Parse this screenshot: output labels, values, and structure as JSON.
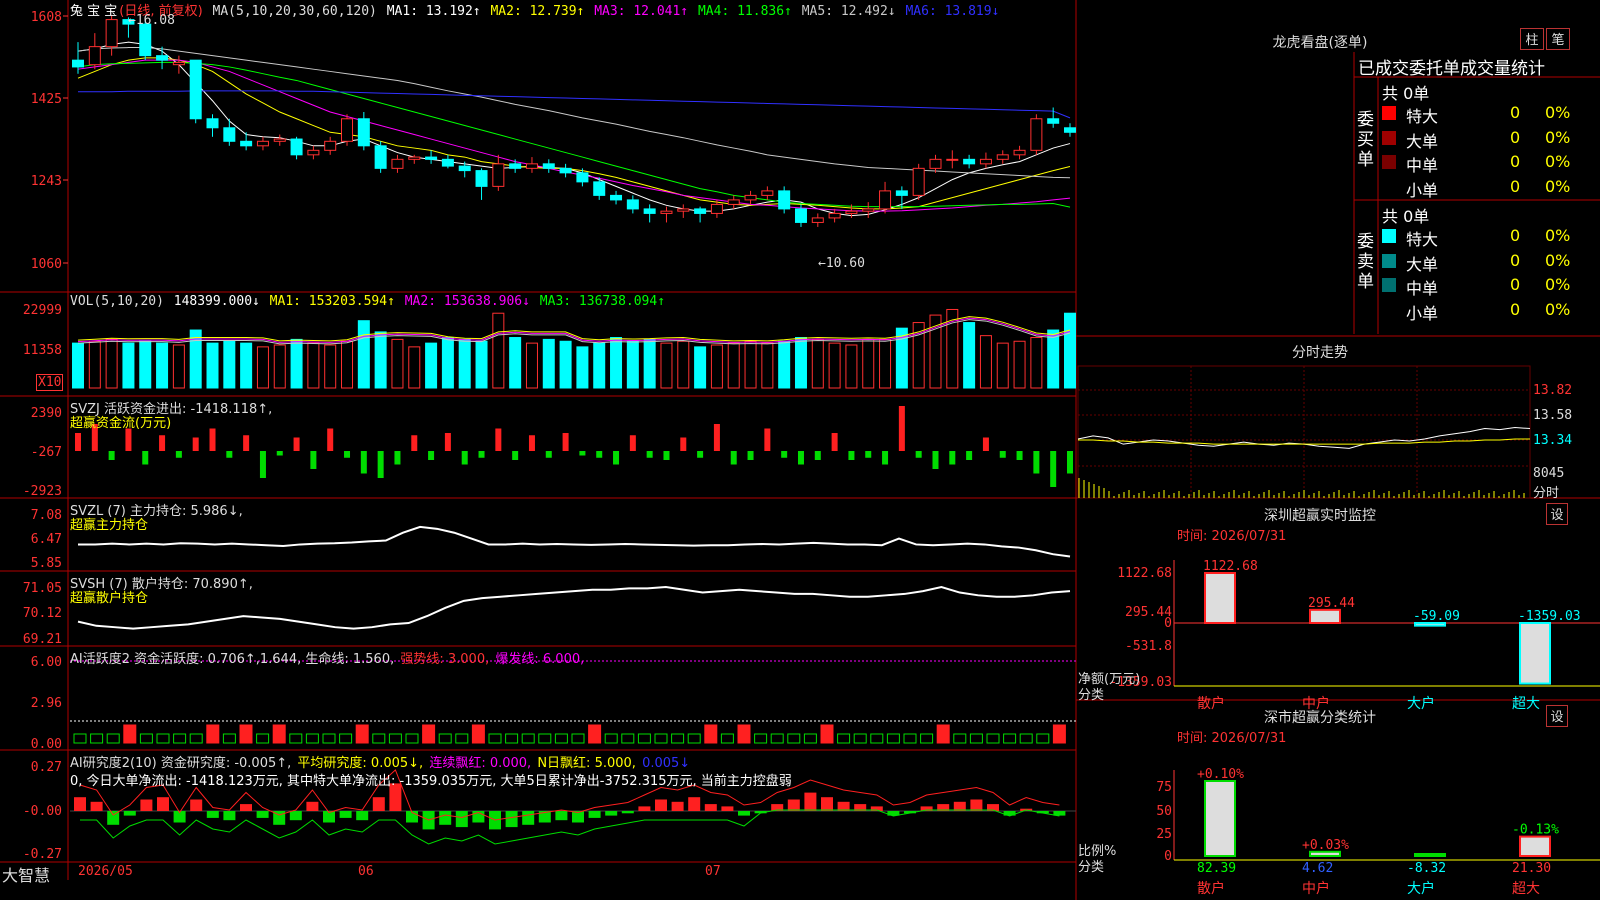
{
  "stock": {
    "name": "兔 宝 宝",
    "period": "(日线, 前复权)"
  },
  "top_header": {
    "ma_def": "MA(5,10,20,30,60,120)",
    "items": [
      {
        "label": "MA1:",
        "value": "13.192↑",
        "color": "#ffffff"
      },
      {
        "label": "MA2:",
        "value": "12.739↑",
        "color": "#ffff00"
      },
      {
        "label": "MA3:",
        "value": "12.041↑",
        "color": "#ff00ff"
      },
      {
        "label": "MA4:",
        "value": "11.836↑",
        "color": "#00ff00"
      },
      {
        "label": "MA5:",
        "value": "12.492↓",
        "color": "#c8c8c8"
      },
      {
        "label": "MA6:",
        "value": "13.819↓",
        "color": "#3030ff"
      }
    ],
    "high_mark": "16.08",
    "low_mark": "←10.60"
  },
  "price_axis": [
    "1608",
    "1425",
    "1243",
    "1060"
  ],
  "vol_panel": {
    "title": "VOL(5,10,20)",
    "vol": "148399.000↓",
    "ma1": "MA1: 153203.594↑",
    "ma2": "MA2: 153638.906↓",
    "ma3": "MA3: 136738.094↑",
    "axis": [
      "22999",
      "11358"
    ],
    "unit": "X10"
  },
  "svzj_panel": {
    "title": "SVZJ  活跃资金进出: -1418.118↑,",
    "subtitle": "超赢资金流(万元)",
    "axis": [
      "2390",
      "-267",
      "-2923"
    ]
  },
  "svzl_panel": {
    "title": "SVZL (7) 主力持仓: 5.986↓,",
    "subtitle": "超赢主力持仓",
    "axis": [
      "7.08",
      "6.47",
      "5.85"
    ]
  },
  "svsh_panel": {
    "title": "SVSH (7) 散户持仓: 70.890↑,",
    "subtitle": "超赢散户持仓",
    "axis": [
      "71.05",
      "70.12",
      "69.21"
    ]
  },
  "ai_active_panel": {
    "title": "AI活跃度2 资金活跃度: 0.706↑,1.644, 生命线: 1.560,",
    "strong": "强势线: 3.000,",
    "burst": "爆发线: 6.000,",
    "axis": [
      "6.00",
      "2.96",
      "0.00"
    ]
  },
  "ai_research_panel": {
    "title": "AI研究度2(10) 资金研究度: -0.005↑,",
    "avg": "平均研究度: 0.005↓,",
    "red": "连续飘红: 0.000,",
    "nred": "N日飘红: 5.000,",
    "last": "0.005↓",
    "summary": "0, 今日大单净流出: -1418.123万元, 其中特大单净流出: -1359.035万元, 大单5日累计净出-3752.315万元, 当前主力控盘弱",
    "axis": [
      "0.27",
      "-0.00",
      "-0.27"
    ]
  },
  "x_axis": {
    "brand": "大智慧",
    "labels": [
      "2026/05",
      "06",
      "07"
    ]
  },
  "right": {
    "lhb_title": "龙虎看盘(逐单)",
    "btn_column": "柱",
    "btn_stroke": "笔",
    "order_title": "已成交委托单成交量统计",
    "buy_label": "委买单",
    "sell_label": "委卖单",
    "buy_total": "共 0单",
    "sell_total": "共 0单",
    "buy_rows": [
      {
        "name": "特大",
        "count": "0",
        "pct": "0%",
        "color": "#ff0000"
      },
      {
        "name": "大单",
        "count": "0",
        "pct": "0%",
        "color": "#a00000"
      },
      {
        "name": "中单",
        "count": "0",
        "pct": "0%",
        "color": "#7a0000"
      },
      {
        "name": "小单",
        "count": "0",
        "pct": "0%",
        "color": ""
      }
    ],
    "sell_rows": [
      {
        "name": "特大",
        "count": "0",
        "pct": "0%",
        "color": "#00ffff"
      },
      {
        "name": "大单",
        "count": "0",
        "pct": "0%",
        "color": "#008b8b"
      },
      {
        "name": "中单",
        "count": "0",
        "pct": "0%",
        "color": "#007070"
      },
      {
        "name": "小单",
        "count": "0",
        "pct": "0%",
        "color": ""
      }
    ],
    "fenshi_title": "分时走势",
    "fenshi_axis": [
      "13.82",
      "13.58",
      "13.34",
      "8045",
      "分时"
    ],
    "sz_title": "深圳超赢实时监控",
    "set_btn": "设",
    "sz_time": "时间: 2026/07/31",
    "sz_axis": [
      "1122.68",
      "295.44",
      "0",
      "-531.8",
      "-1359.03"
    ],
    "sz_ylabel": "净额(万元)",
    "sz_xlabel": "分类",
    "sz_bars": [
      {
        "cat": "散户",
        "value": 1122.68,
        "label": "1122.68"
      },
      {
        "cat": "中户",
        "value": 295.44,
        "label": "295.44"
      },
      {
        "cat": "大户",
        "value": -59.09,
        "label": "-59.09"
      },
      {
        "cat": "超大",
        "value": -1359.03,
        "label": "-1359.03"
      }
    ],
    "cls_title": "深市超赢分类统计",
    "cls_time": "时间: 2026/07/31",
    "cls_axis": [
      "75",
      "50",
      "25",
      "0"
    ],
    "cls_ylabel": "比例%",
    "cls_xlabel": "分类",
    "cls_bars": [
      {
        "cat": "散户",
        "top": "+0.10%",
        "bottom": "82.39",
        "value": 82.39
      },
      {
        "cat": "中户",
        "top": "+0.03%",
        "bottom": "4.62",
        "value": 4.62
      },
      {
        "cat": "大户",
        "top": "",
        "bottom": "-8.32",
        "value": 0
      },
      {
        "cat": "超大",
        "top": "-0.13%",
        "bottom": "21.30",
        "value": 21.3
      }
    ]
  },
  "chart_data": {
    "type": "candlestick",
    "title": "兔宝宝 日线 前复权",
    "price_range": [
      10.6,
      16.08
    ],
    "candles": [
      [
        15.1,
        14.95,
        15.5,
        14.8
      ],
      [
        15.0,
        15.4,
        15.7,
        14.9
      ],
      [
        15.4,
        16.0,
        16.08,
        15.2
      ],
      [
        16.0,
        15.9,
        16.05,
        15.6
      ],
      [
        15.9,
        15.2,
        16.0,
        15.1
      ],
      [
        15.2,
        15.1,
        15.4,
        14.9
      ],
      [
        15.0,
        15.05,
        15.2,
        14.8
      ],
      [
        15.1,
        13.8,
        15.1,
        13.7
      ],
      [
        13.8,
        13.6,
        13.9,
        13.4
      ],
      [
        13.6,
        13.3,
        13.8,
        13.2
      ],
      [
        13.3,
        13.2,
        13.5,
        13.1
      ],
      [
        13.2,
        13.3,
        13.4,
        13.1
      ],
      [
        13.3,
        13.35,
        13.45,
        13.2
      ],
      [
        13.35,
        13.0,
        13.4,
        12.9
      ],
      [
        13.0,
        13.1,
        13.2,
        12.9
      ],
      [
        13.1,
        13.3,
        13.4,
        13.0
      ],
      [
        13.3,
        13.8,
        13.9,
        13.2
      ],
      [
        13.8,
        13.2,
        13.95,
        13.1
      ],
      [
        13.2,
        12.7,
        13.3,
        12.6
      ],
      [
        12.7,
        12.9,
        13.0,
        12.6
      ],
      [
        12.9,
        12.95,
        13.0,
        12.8
      ],
      [
        12.95,
        12.9,
        13.1,
        12.8
      ],
      [
        12.9,
        12.75,
        13.0,
        12.7
      ],
      [
        12.75,
        12.65,
        12.85,
        12.5
      ],
      [
        12.65,
        12.3,
        12.7,
        12.0
      ],
      [
        12.3,
        12.8,
        13.0,
        12.2
      ],
      [
        12.8,
        12.7,
        12.9,
        12.6
      ],
      [
        12.7,
        12.8,
        12.95,
        12.6
      ],
      [
        12.8,
        12.7,
        12.9,
        12.6
      ],
      [
        12.7,
        12.6,
        12.8,
        12.5
      ],
      [
        12.6,
        12.4,
        12.7,
        12.3
      ],
      [
        12.4,
        12.1,
        12.5,
        12.0
      ],
      [
        12.1,
        12.0,
        12.2,
        11.9
      ],
      [
        12.0,
        11.8,
        12.1,
        11.7
      ],
      [
        11.8,
        11.7,
        11.9,
        11.5
      ],
      [
        11.7,
        11.75,
        11.85,
        11.5
      ],
      [
        11.75,
        11.8,
        11.9,
        11.6
      ],
      [
        11.8,
        11.7,
        11.85,
        11.5
      ],
      [
        11.7,
        11.9,
        12.0,
        11.6
      ],
      [
        11.9,
        12.0,
        12.1,
        11.8
      ],
      [
        12.0,
        12.1,
        12.2,
        11.9
      ],
      [
        12.1,
        12.2,
        12.3,
        12.0
      ],
      [
        12.2,
        11.8,
        12.3,
        11.7
      ],
      [
        11.8,
        11.5,
        11.9,
        11.4
      ],
      [
        11.5,
        11.6,
        11.7,
        11.4
      ],
      [
        11.6,
        11.7,
        11.8,
        11.5
      ],
      [
        11.7,
        11.75,
        11.9,
        11.6
      ],
      [
        11.75,
        11.8,
        11.95,
        11.6
      ],
      [
        11.8,
        12.2,
        12.4,
        11.7
      ],
      [
        12.2,
        12.1,
        12.3,
        11.8
      ],
      [
        12.1,
        12.7,
        12.8,
        12.0
      ],
      [
        12.7,
        12.9,
        13.0,
        12.6
      ],
      [
        12.9,
        12.9,
        13.1,
        12.7
      ],
      [
        12.9,
        12.8,
        13.0,
        12.7
      ],
      [
        12.8,
        12.9,
        13.05,
        12.7
      ],
      [
        12.9,
        13.0,
        13.1,
        12.8
      ],
      [
        13.0,
        13.1,
        13.2,
        12.9
      ],
      [
        13.1,
        13.8,
        13.9,
        13.0
      ],
      [
        13.8,
        13.7,
        14.05,
        13.6
      ],
      [
        13.6,
        13.5,
        13.7,
        13.4
      ]
    ],
    "ma_series": [
      {
        "name": "MA1",
        "color": "#ffffff",
        "values": [
          15.3,
          15.35,
          15.45,
          15.5,
          15.45,
          15.3,
          15.0,
          14.6,
          14.2,
          13.75,
          13.45,
          13.4,
          13.38,
          13.3,
          13.2,
          13.2,
          13.3,
          13.35,
          13.2,
          13.05,
          12.95,
          12.9,
          12.85,
          12.8,
          12.75,
          12.7,
          12.72,
          12.75,
          12.72,
          12.7,
          12.6,
          12.45,
          12.3,
          12.15,
          12.0,
          11.88,
          11.8,
          11.75,
          11.75,
          11.8,
          11.88,
          11.95,
          12.0,
          11.95,
          11.8,
          11.7,
          11.65,
          11.68,
          11.78,
          11.9,
          12.05,
          12.25,
          12.45,
          12.6,
          12.7,
          12.78,
          12.85,
          13.0,
          13.15,
          13.25
        ]
      },
      {
        "name": "MA2",
        "color": "#ffff00",
        "values": [
          14.7,
          14.85,
          15.0,
          15.1,
          15.15,
          15.15,
          15.1,
          15.0,
          14.85,
          14.6,
          14.35,
          14.15,
          13.95,
          13.8,
          13.65,
          13.5,
          13.45,
          13.4,
          13.3,
          13.2,
          13.15,
          13.1,
          13.0,
          12.95,
          12.85,
          12.8,
          12.75,
          12.72,
          12.7,
          12.7,
          12.65,
          12.58,
          12.5,
          12.4,
          12.3,
          12.2,
          12.1,
          12.0,
          11.95,
          11.9,
          11.88,
          11.9,
          11.92,
          11.9,
          11.88,
          11.85,
          11.82,
          11.8,
          11.8,
          11.82,
          11.85,
          11.95,
          12.05,
          12.15,
          12.25,
          12.35,
          12.45,
          12.55,
          12.65,
          12.74
        ]
      },
      {
        "name": "MA3",
        "color": "#ff00ff",
        "values": [
          14.9,
          14.95,
          15.0,
          15.05,
          15.1,
          15.1,
          15.1,
          15.05,
          14.95,
          14.85,
          14.7,
          14.55,
          14.4,
          14.25,
          14.1,
          13.95,
          13.85,
          13.75,
          13.65,
          13.55,
          13.45,
          13.35,
          13.25,
          13.15,
          13.05,
          12.95,
          12.85,
          12.78,
          12.7,
          12.62,
          12.55,
          12.48,
          12.4,
          12.32,
          12.25,
          12.18,
          12.1,
          12.05,
          12.0,
          11.95,
          11.9,
          11.88,
          11.85,
          11.82,
          11.8,
          11.78,
          11.76,
          11.75,
          11.75,
          11.76,
          11.78,
          11.8,
          11.82,
          11.85,
          11.88,
          11.9,
          11.93,
          11.96,
          12.0,
          12.04
        ]
      },
      {
        "name": "MA4",
        "color": "#00ff00",
        "values": [
          14.95,
          15.0,
          15.02,
          15.03,
          15.04,
          15.05,
          15.05,
          15.03,
          15.0,
          14.95,
          14.88,
          14.8,
          14.72,
          14.65,
          14.55,
          14.45,
          14.35,
          14.25,
          14.15,
          14.05,
          13.95,
          13.85,
          13.75,
          13.65,
          13.55,
          13.45,
          13.35,
          13.25,
          13.15,
          13.05,
          12.95,
          12.85,
          12.75,
          12.65,
          12.55,
          12.45,
          12.35,
          12.25,
          12.18,
          12.1,
          12.05,
          12.0,
          11.95,
          11.92,
          11.9,
          11.88,
          11.86,
          11.85,
          11.85,
          11.85,
          11.85,
          11.86,
          11.87,
          11.88,
          11.89,
          11.9,
          11.9,
          11.91,
          11.92,
          11.84
        ]
      },
      {
        "name": "MA5",
        "color": "#c8c8c8",
        "values": [
          15.3,
          15.35,
          15.37,
          15.38,
          15.38,
          15.35,
          15.3,
          15.25,
          15.2,
          15.15,
          15.1,
          15.05,
          15.0,
          14.95,
          14.9,
          14.85,
          14.8,
          14.75,
          14.7,
          14.65,
          14.58,
          14.5,
          14.42,
          14.35,
          14.28,
          14.2,
          14.12,
          14.05,
          13.98,
          13.9,
          13.82,
          13.75,
          13.68,
          13.6,
          13.52,
          13.45,
          13.38,
          13.3,
          13.22,
          13.15,
          13.08,
          13.0,
          12.95,
          12.9,
          12.85,
          12.8,
          12.76,
          12.72,
          12.7,
          12.68,
          12.66,
          12.64,
          12.62,
          12.6,
          12.58,
          12.56,
          12.54,
          12.52,
          12.5,
          12.49
        ]
      },
      {
        "name": "MA6",
        "color": "#3030ff",
        "values": [
          14.4,
          14.4,
          14.4,
          14.41,
          14.41,
          14.41,
          14.41,
          14.42,
          14.42,
          14.42,
          14.42,
          14.42,
          14.42,
          14.41,
          14.41,
          14.4,
          14.39,
          14.38,
          14.37,
          14.36,
          14.35,
          14.34,
          14.33,
          14.32,
          14.31,
          14.3,
          14.29,
          14.28,
          14.27,
          14.26,
          14.25,
          14.24,
          14.23,
          14.22,
          14.21,
          14.2,
          14.19,
          14.18,
          14.17,
          14.16,
          14.15,
          14.14,
          14.13,
          14.12,
          14.11,
          14.1,
          14.09,
          14.08,
          14.07,
          14.06,
          14.05,
          14.04,
          14.03,
          14.02,
          14.01,
          14.0,
          13.99,
          13.98,
          13.97,
          13.82
        ]
      }
    ],
    "volume": [
      1.2,
      1.25,
      1.3,
      1.2,
      1.25,
      1.2,
      1.15,
      1.55,
      1.2,
      1.25,
      1.2,
      1.1,
      1.15,
      1.3,
      1.2,
      1.15,
      1.25,
      1.8,
      1.5,
      1.3,
      1.1,
      1.2,
      1.35,
      1.3,
      1.25,
      2.0,
      1.35,
      1.2,
      1.3,
      1.25,
      1.1,
      1.2,
      1.35,
      1.25,
      1.3,
      1.2,
      1.25,
      1.1,
      1.15,
      1.2,
      1.25,
      1.2,
      1.25,
      1.35,
      1.3,
      1.2,
      1.15,
      1.3,
      1.3,
      1.6,
      1.75,
      1.95,
      2.1,
      1.75,
      1.4,
      1.2,
      1.25,
      1.35,
      1.55,
      2.0,
      1.6,
      1.45
    ],
    "svzj": [
      400,
      600,
      -200,
      500,
      -300,
      350,
      -150,
      300,
      500,
      -150,
      350,
      -600,
      -100,
      300,
      -400,
      500,
      -150,
      -500,
      -600,
      -300,
      350,
      -200,
      400,
      -300,
      -150,
      500,
      -200,
      350,
      -150,
      400,
      -100,
      -150,
      -300,
      350,
      -150,
      -200,
      300,
      -150,
      600,
      -300,
      -200,
      500,
      -150,
      -300,
      -200,
      400,
      -200,
      -150,
      -300,
      1000,
      -150,
      -400,
      -300,
      -200,
      300,
      -150,
      -200,
      -500,
      -800,
      -500
    ],
    "svzl": [
      6.3,
      6.3,
      6.32,
      6.3,
      6.32,
      6.3,
      6.33,
      6.32,
      6.3,
      6.32,
      6.3,
      6.28,
      6.26,
      6.3,
      6.32,
      6.33,
      6.35,
      6.38,
      6.4,
      6.6,
      6.75,
      6.7,
      6.6,
      6.45,
      6.3,
      6.3,
      6.32,
      6.3,
      6.31,
      6.3,
      6.29,
      6.3,
      6.31,
      6.3,
      6.29,
      6.28,
      6.27,
      6.28,
      6.28,
      6.3,
      6.31,
      6.3,
      6.32,
      6.34,
      6.32,
      6.3,
      6.3,
      6.28,
      6.45,
      6.3,
      6.28,
      6.3,
      6.32,
      6.3,
      6.25,
      6.22,
      6.15,
      6.05,
      5.99
    ],
    "svsh": [
      69.8,
      69.65,
      69.6,
      69.55,
      69.6,
      69.65,
      69.7,
      69.8,
      69.9,
      70.0,
      69.95,
      69.9,
      69.8,
      69.7,
      69.6,
      69.55,
      69.6,
      69.7,
      69.75,
      70.0,
      70.3,
      70.55,
      70.65,
      70.7,
      70.75,
      70.8,
      70.85,
      70.9,
      70.95,
      70.95,
      71.0,
      71.0,
      71.05,
      70.95,
      70.85,
      70.9,
      70.95,
      70.9,
      70.85,
      70.8,
      70.8,
      70.75,
      70.7,
      70.7,
      70.75,
      70.8,
      70.9,
      71.05,
      70.85,
      70.75,
      70.7,
      70.7,
      70.75,
      70.85,
      70.9
    ],
    "fenshi_price": [
      13.35,
      13.38,
      13.36,
      13.3,
      13.32,
      13.34,
      13.33,
      13.31,
      13.29,
      13.28,
      13.3,
      13.32,
      13.3,
      13.29,
      13.31,
      13.3,
      13.28,
      13.27,
      13.26,
      13.3,
      13.32,
      13.34,
      13.33,
      13.35,
      13.38,
      13.4,
      13.42,
      13.45,
      13.44,
      13.46,
      13.45
    ],
    "fenshi_avg": [
      13.34,
      13.34,
      13.33,
      13.33,
      13.32,
      13.32,
      13.31,
      13.31,
      13.31,
      13.3,
      13.3,
      13.3,
      13.3,
      13.3,
      13.3,
      13.3,
      13.3,
      13.3,
      13.3,
      13.3,
      13.31,
      13.31,
      13.31,
      13.32,
      13.32,
      13.33,
      13.33,
      13.34,
      13.34,
      13.35,
      13.35
    ]
  }
}
